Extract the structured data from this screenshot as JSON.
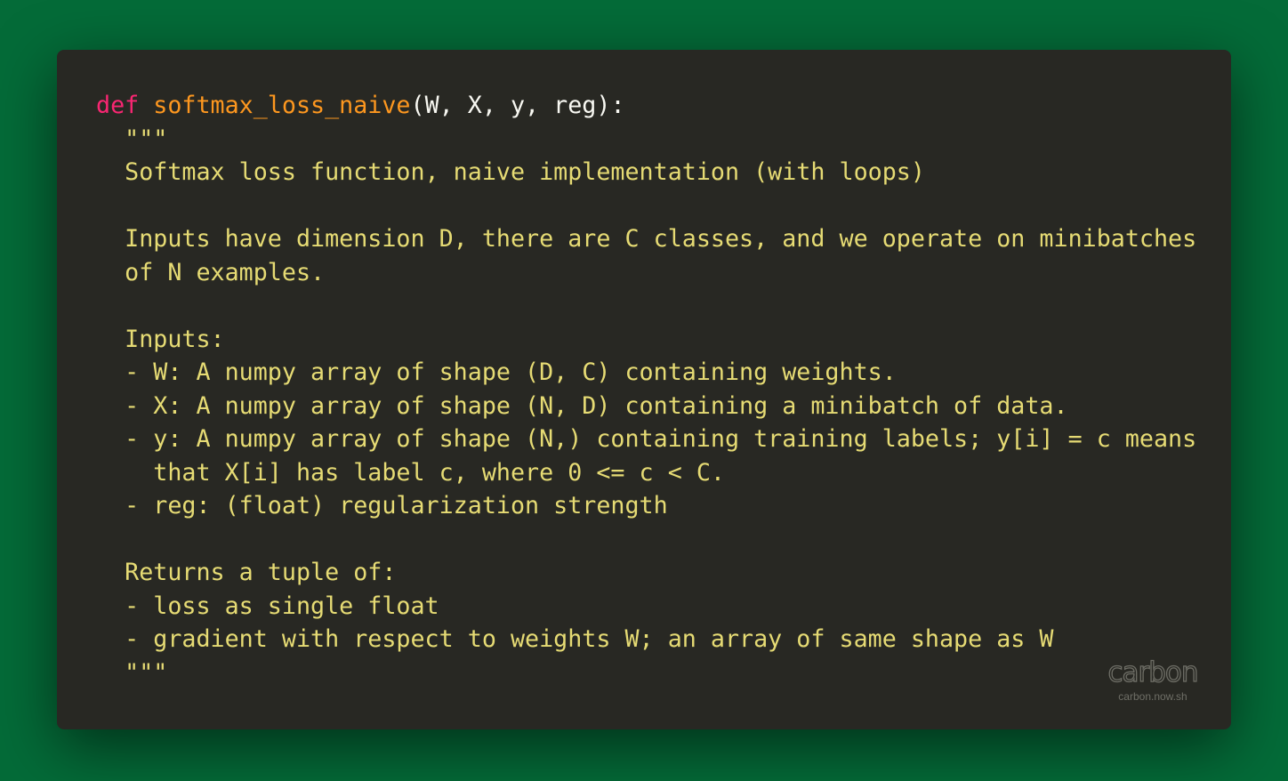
{
  "editor": {
    "line1": {
      "keyword": "def",
      "function_name": "softmax_loss_naive",
      "signature": "(W, X, y, reg):"
    },
    "docstring": [
      "  \"\"\"",
      "  Softmax loss function, naive implementation (with loops)",
      "",
      "  Inputs have dimension D, there are C classes, and we operate on minibatches",
      "  of N examples.",
      "",
      "  Inputs:",
      "  - W: A numpy array of shape (D, C) containing weights.",
      "  - X: A numpy array of shape (N, D) containing a minibatch of data.",
      "  - y: A numpy array of shape (N,) containing training labels; y[i] = c means",
      "    that X[i] has label c, where 0 <= c < C.",
      "  - reg: (float) regularization strength",
      "",
      "  Returns a tuple of:",
      "  - loss as single float",
      "  - gradient with respect to weights W; an array of same shape as W",
      "  \"\"\""
    ]
  },
  "watermark": {
    "logo": "carbon",
    "url": "carbon.now.sh"
  },
  "colors": {
    "background": "#046b38",
    "editor_bg": "#282823",
    "keyword": "#f92672",
    "function": "#fd971f",
    "plain": "#f8f8f2",
    "docstring": "#e6db74"
  }
}
